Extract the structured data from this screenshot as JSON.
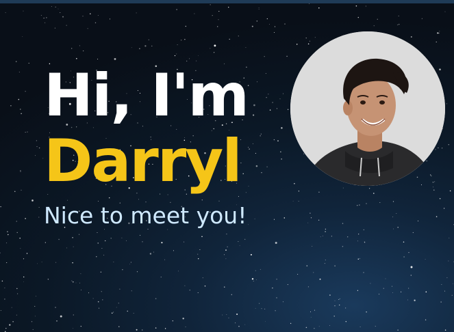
{
  "hero": {
    "greeting": "Hi, I'm",
    "name": "Darryl",
    "tagline": "Nice to meet you!"
  },
  "avatar": {
    "description_icon": "profile-photo"
  },
  "colors": {
    "background": "#0b1826",
    "greeting": "#ffffff",
    "name_accent": "#f5c518",
    "tagline": "#cfe9ff",
    "avatar_bg": "#d9d9d9"
  }
}
